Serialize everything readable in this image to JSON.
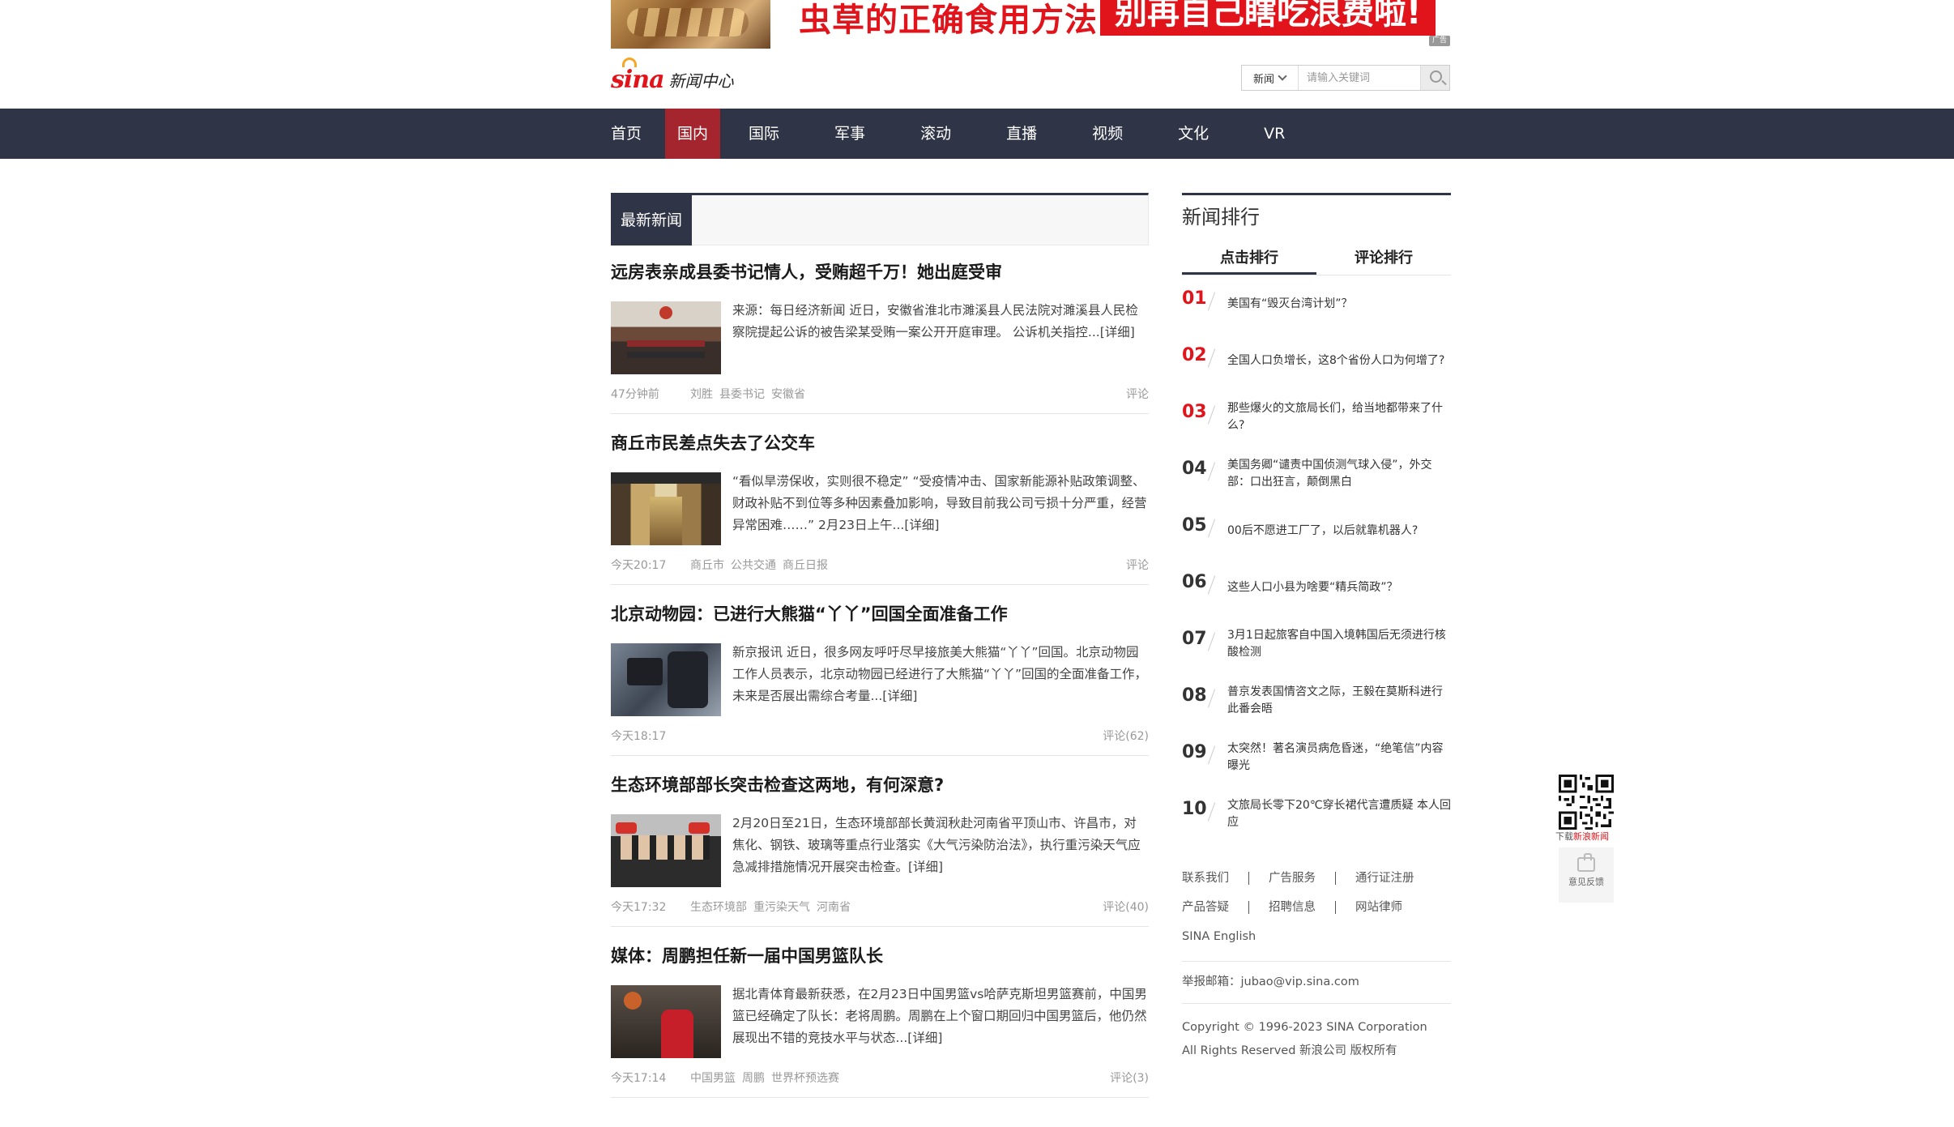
{
  "ad": {
    "text1": "虫草的正确食用方法",
    "text2": "别再自己瞎吃浪费啦!",
    "tag": "广告"
  },
  "logo": {
    "brand": "sina",
    "channel": "新闻中心"
  },
  "search": {
    "scope": "新闻",
    "placeholder": "请输入关键词"
  },
  "nav": {
    "items": [
      "首页",
      "国内",
      "国际",
      "军事",
      "滚动",
      "直播",
      "视频",
      "文化",
      "VR"
    ],
    "active": "国内"
  },
  "latest": {
    "tab_label": "最新新闻"
  },
  "news": [
    {
      "title": "远房表亲成县委书记情人，受贿超千万！她出庭受审",
      "desc": "来源：每日经济新闻 近日，安徽省淮北市濉溪县人民法院对濉溪县人民检察院提起公诉的被告梁某受贿一案公开开庭审理。 公诉机关指控...[详细]",
      "time": "47分钟前",
      "tags": [
        "刘胜",
        "县委书记",
        "安徽省"
      ],
      "comment": "评论"
    },
    {
      "title": "商丘市民差点失去了公交车",
      "desc": "“看似旱涝保收，实则很不稳定” “受疫情冲击、国家新能源补贴政策调整、财政补贴不到位等多种因素叠加影响，导致目前我公司亏损十分严重，经营异常困难……” 2月23日上午...[详细]",
      "time": "今天20:17",
      "tags": [
        "商丘市",
        "公共交通",
        "商丘日报"
      ],
      "comment": "评论"
    },
    {
      "title": "北京动物园：已进行大熊猫“丫丫”回国全面准备工作",
      "desc": "新京报讯 近日，很多网友呼吁尽早接旅美大熊猫“丫丫”回国。北京动物园工作人员表示，北京动物园已经进行了大熊猫“丫丫”回国的全面准备工作，未来是否展出需综合考量...[详细]",
      "time": "今天18:17",
      "tags": [],
      "comment": "评论(62)"
    },
    {
      "title": "生态环境部部长突击检查这两地，有何深意?",
      "desc": "2月20日至21日，生态环境部部长黄润秋赴河南省平顶山市、许昌市，对焦化、钢铁、玻璃等重点行业落实《大气污染防治法》，执行重污染天气应急减排措施情况开展突击检查。[详细]",
      "time": "今天17:32",
      "tags": [
        "生态环境部",
        "重污染天气",
        "河南省"
      ],
      "comment": "评论(40)"
    },
    {
      "title": "媒体：周鹏担任新一届中国男篮队长",
      "desc": "据北青体育最新获悉，在2月23日中国男篮vs哈萨克斯坦男篮赛前，中国男篮已经确定了队长：老将周鹏。周鹏在上个窗口期回归中国男篮后，他仍然展现出不错的竞技水平与状态...[详细]",
      "time": "今天17:14",
      "tags": [
        "中国男篮",
        "周鹏",
        "世界杯预选赛"
      ],
      "comment": "评论(3)"
    }
  ],
  "ranking": {
    "title": "新闻排行",
    "tabs": [
      "点击排行",
      "评论排行"
    ],
    "items": [
      {
        "num": "01",
        "text": "美国有“毁灭台湾计划”？"
      },
      {
        "num": "02",
        "text": "全国人口负增长，这8个省份人口为何增了?"
      },
      {
        "num": "03",
        "text": "那些爆火的文旅局长们，给当地都带来了什么?"
      },
      {
        "num": "04",
        "text": "美国务卿“谴责中国侦测气球入侵”，外交部：口出狂言，颠倒黑白"
      },
      {
        "num": "05",
        "text": "00后不愿进工厂了，以后就靠机器人?"
      },
      {
        "num": "06",
        "text": "这些人口小县为啥要“精兵简政”？"
      },
      {
        "num": "07",
        "text": "3月1日起旅客自中国入境韩国后无须进行核酸检测"
      },
      {
        "num": "08",
        "text": "普京发表国情咨文之际，王毅在莫斯科进行此番会晤"
      },
      {
        "num": "09",
        "text": "太突然！著名演员病危昏迷，“绝笔信”内容曝光"
      },
      {
        "num": "10",
        "text": "文旅局长零下20℃穿长裙代言遭质疑 本人回应"
      }
    ]
  },
  "footer_links": {
    "row1": [
      "联系我们",
      "广告服务",
      "通行证注册"
    ],
    "row2": [
      "产品答疑",
      "招聘信息",
      "网站律师"
    ],
    "row3": "SINA English"
  },
  "report": "举报邮箱：jubao@vip.sina.com",
  "copyright": {
    "line1": "Copyright © 1996-2023 SINA Corporation",
    "line2": "All Rights Reserved 新浪公司 版权所有"
  },
  "float": {
    "download_prefix": "下载",
    "download_app": "新浪新闻",
    "feedback": "意见反馈"
  },
  "colors": {
    "nav_bg": "#2f3447",
    "nav_active": "#a4252e",
    "brand_red": "#e1141b"
  }
}
